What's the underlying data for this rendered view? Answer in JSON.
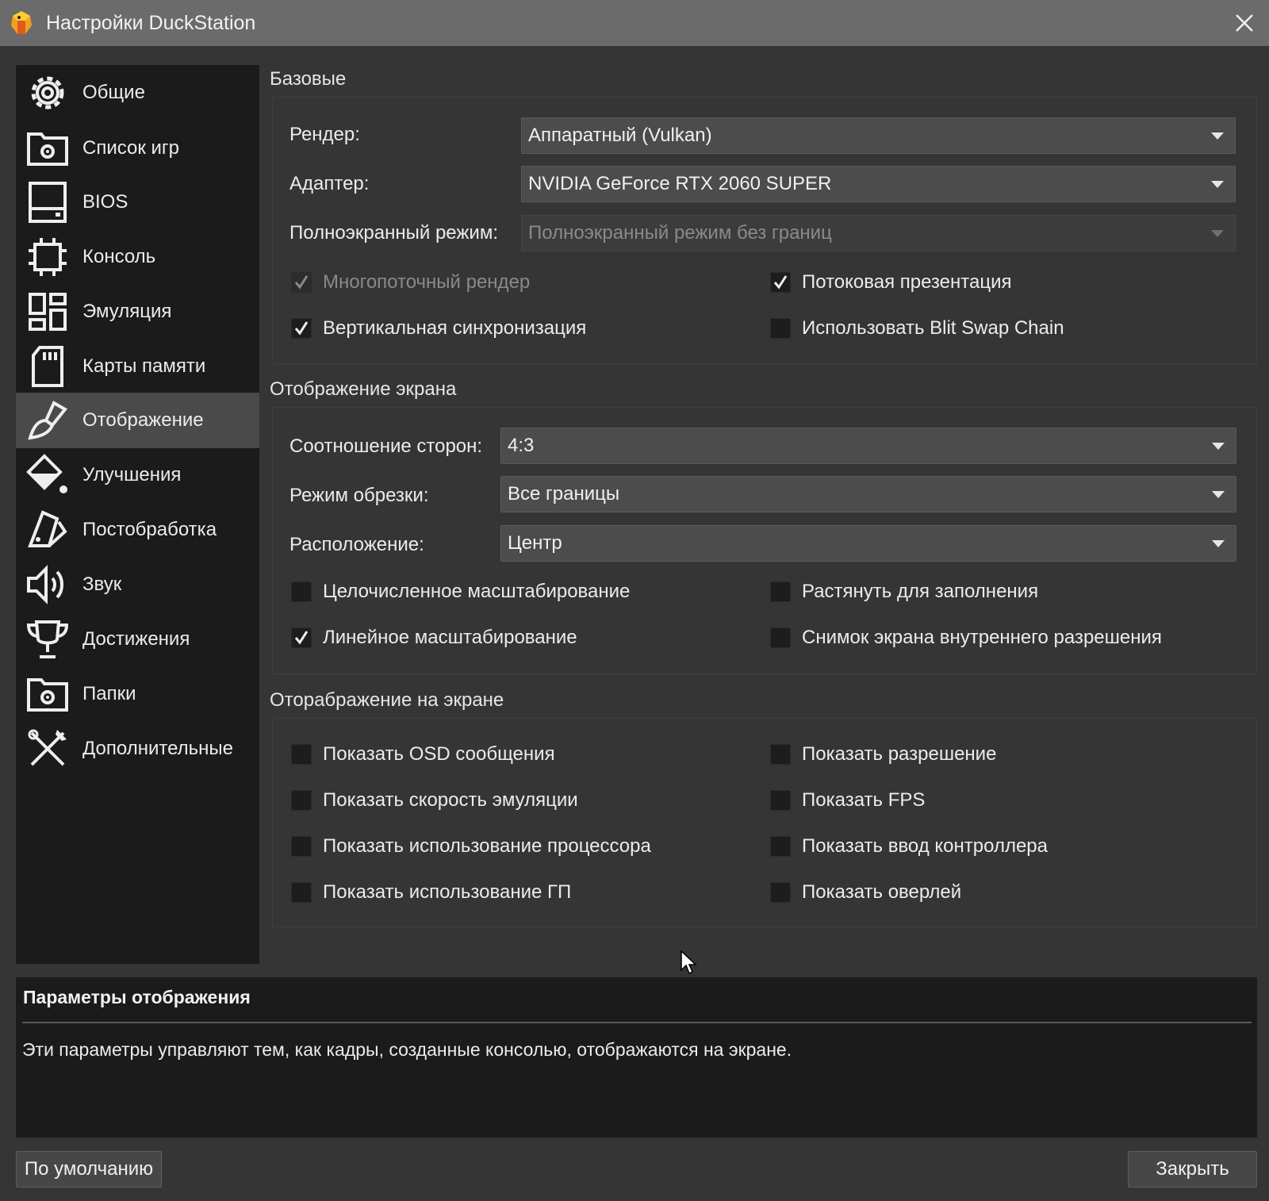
{
  "window": {
    "title": "Настройки DuckStation"
  },
  "sidebar": {
    "items": [
      {
        "label": "Общие",
        "icon": "gear-icon"
      },
      {
        "label": "Список игр",
        "icon": "folder-gear-icon"
      },
      {
        "label": "BIOS",
        "icon": "drive-icon"
      },
      {
        "label": "Консоль",
        "icon": "chip-icon"
      },
      {
        "label": "Эмуляция",
        "icon": "dashboard-icon"
      },
      {
        "label": "Карты памяти",
        "icon": "memory-card-icon"
      },
      {
        "label": "Отображение",
        "icon": "brush-icon",
        "active": true
      },
      {
        "label": "Улучшения",
        "icon": "paint-bucket-icon"
      },
      {
        "label": "Постобработка",
        "icon": "color-swatch-icon"
      },
      {
        "label": "Звук",
        "icon": "speaker-icon"
      },
      {
        "label": "Достижения",
        "icon": "trophy-icon"
      },
      {
        "label": "Папки",
        "icon": "folder-settings-icon"
      },
      {
        "label": "Дополнительные",
        "icon": "tools-icon"
      }
    ]
  },
  "basic": {
    "title": "Базовые",
    "renderer": {
      "label": "Рендер:",
      "value": "Аппаратный (Vulkan)"
    },
    "adapter": {
      "label": "Адаптер:",
      "value": "NVIDIA GeForce RTX 2060 SUPER"
    },
    "fullscreen": {
      "label": "Полноэкранный режим:",
      "value": "Полноэкранный режим без границ"
    },
    "threaded_render": {
      "label": "Многопоточный рендер",
      "checked": true,
      "disabled": true
    },
    "threaded_presentation": {
      "label": "Потоковая презентация",
      "checked": true
    },
    "vsync": {
      "label": "Вертикальная синхронизация",
      "checked": true
    },
    "blit_swap_chain": {
      "label": "Использовать Blit Swap Chain",
      "checked": false
    }
  },
  "display": {
    "title": "Отображение экрана",
    "aspect": {
      "label": "Соотношение сторон:",
      "value": "4:3"
    },
    "crop": {
      "label": "Режим обрезки:",
      "value": "Все границы"
    },
    "alignment": {
      "label": "Расположение:",
      "value": "Центр"
    },
    "integer_scaling": {
      "label": "Целочисленное масштабирование",
      "checked": false
    },
    "stretch": {
      "label": "Растянуть для заполнения",
      "checked": false
    },
    "linear_filtering": {
      "label": "Линейное масштабирование",
      "checked": true
    },
    "internal_res_screenshots": {
      "label": "Снимок экрана внутреннего разрешения",
      "checked": false
    }
  },
  "osd": {
    "title": "Оторабражение на экране",
    "show_osd": {
      "label": "Показать OSD сообщения",
      "checked": false
    },
    "show_resolution": {
      "label": "Показать разрешение",
      "checked": false
    },
    "show_speed": {
      "label": "Показать скорость эмуляции",
      "checked": false
    },
    "show_fps": {
      "label": "Показать FPS",
      "checked": false
    },
    "show_cpu": {
      "label": "Показать использование процессора",
      "checked": false
    },
    "show_inputs": {
      "label": "Показать ввод контроллера",
      "checked": false
    },
    "show_gpu": {
      "label": "Показать использование ГП",
      "checked": false
    },
    "show_overlay": {
      "label": "Показать оверлей",
      "checked": false
    }
  },
  "description": {
    "title": "Параметры отображения",
    "text": "Эти параметры управляют тем, как кадры, созданные консолью, отображаются на экране."
  },
  "buttons": {
    "defaults": "По умолчанию",
    "close": "Закрыть"
  },
  "colors": {
    "sidebar_bg": "#1b1b1b",
    "window_bg": "#353535",
    "titlebar_bg": "#6b6b6b",
    "active_item": "#4a4a4a"
  }
}
